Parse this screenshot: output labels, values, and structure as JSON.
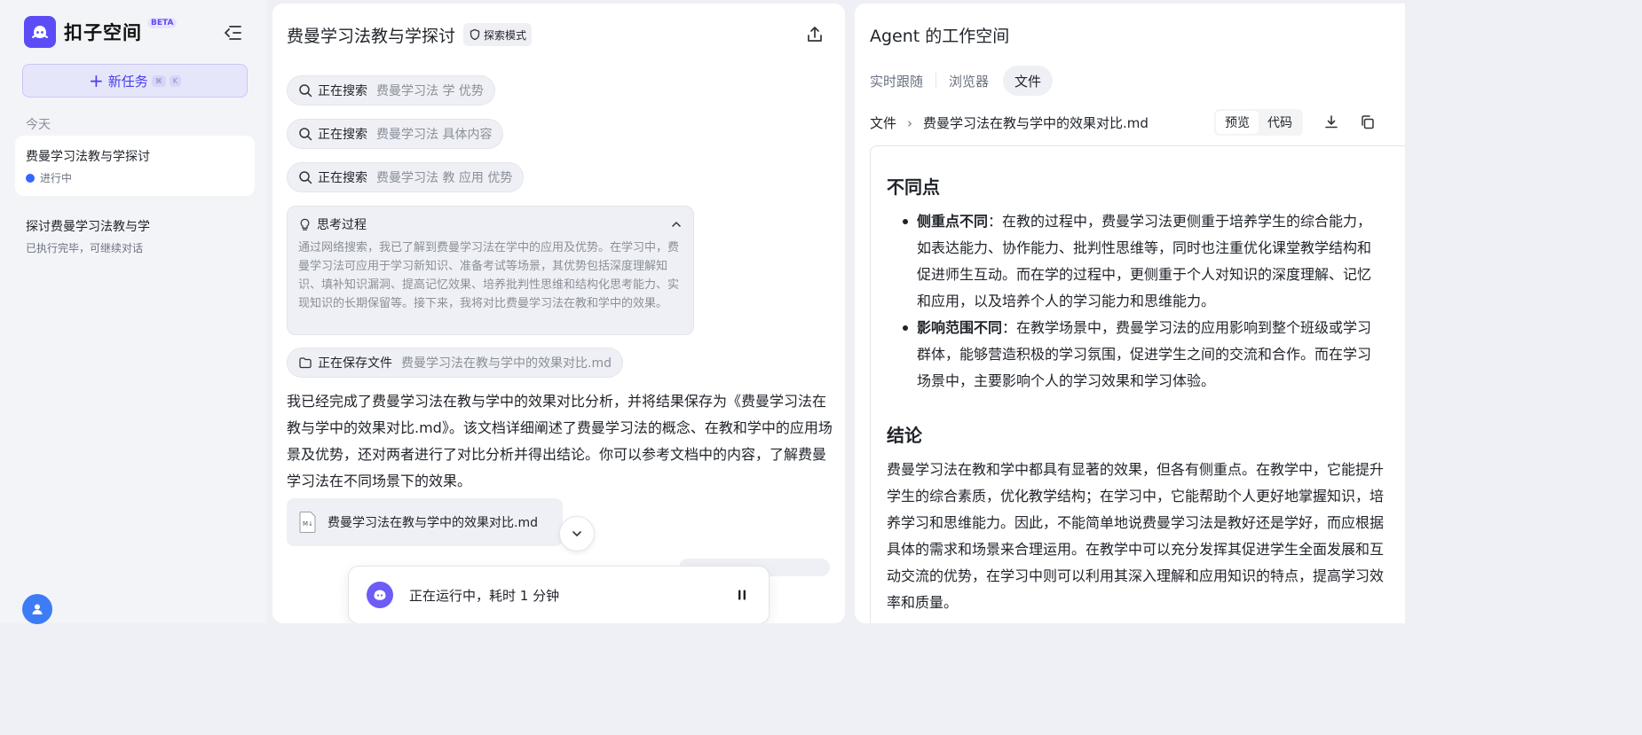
{
  "sidebar": {
    "brand": "扣子空间",
    "beta": "BETA",
    "new_task_label": "新任务",
    "new_task_kbd_1": "⌘",
    "new_task_kbd_2": "K",
    "section_today": "今天",
    "tasks": [
      {
        "title": "费曼学习法教与学探讨",
        "status": "进行中"
      },
      {
        "title": "探讨费曼学习法教与学",
        "status": "已执行完毕，可继续对话"
      }
    ]
  },
  "chat": {
    "title": "费曼学习法教与学探讨",
    "mode": "探索模式",
    "searches": [
      {
        "action": "正在搜索",
        "query": "费曼学习法 学 优势"
      },
      {
        "action": "正在搜索",
        "query": "费曼学习法 具体内容"
      },
      {
        "action": "正在搜索",
        "query": "费曼学习法 教 应用 优势"
      }
    ],
    "thinking": {
      "label": "思考过程",
      "text": "通过网络搜索，我已了解到费曼学习法在学中的应用及优势。在学习中，费曼学习法可应用于学习新知识、准备考试等场景，其优势包括深度理解知识、填补知识漏洞、提高记忆效果、培养批判性思维和结构化思考能力、实现知识的长期保留等。接下来，我将对比费曼学习法在教和学中的效果。"
    },
    "saving": {
      "action": "正在保存文件",
      "file": "费曼学习法在教与学中的效果对比.md"
    },
    "answer": "我已经完成了费曼学习法在教与学中的效果对比分析，并将结果保存为《费曼学习法在教与学中的效果对比.md》。该文档详细阐述了费曼学习法的概念、在教和学中的应用场景及优势，还对两者进行了对比分析并得出结论。你可以参考文档中的内容，了解费曼学习法在不同场景下的效果。",
    "file_card": {
      "icon_label": "M↓",
      "name": "费曼学习法在教与学中的效果对比.md"
    },
    "run_status": "正在运行中，耗时 1 分钟"
  },
  "workspace": {
    "title": "Agent 的工作空间",
    "tabs": [
      "实时跟随",
      "浏览器",
      "文件"
    ],
    "active_tab": "文件",
    "breadcrumb": {
      "root": "文件",
      "file": "费曼学习法在教与学中的效果对比.md"
    },
    "view_options": [
      "预览",
      "代码"
    ],
    "active_view": "预览",
    "doc": {
      "heading_diff": "不同点",
      "bullets": [
        {
          "bold": "侧重点不同",
          "text": "：在教的过程中，费曼学习法更侧重于培养学生的综合能力，如表达能力、协作能力、批判性思维等，同时也注重优化课堂教学结构和促进师生互动。而在学的过程中，更侧重于个人对知识的深度理解、记忆和应用，以及培养个人的学习能力和思维能力。"
        },
        {
          "bold": "影响范围不同",
          "text": "：在教学场景中，费曼学习法的应用影响到整个班级或学习群体，能够营造积极的学习氛围，促进学生之间的交流和合作。而在学习场景中，主要影响个人的学习效果和学习体验。"
        }
      ],
      "heading_conclusion": "结论",
      "conclusion": "费曼学习法在教和学中都具有显著的效果，但各有侧重点。在教学中，它能提升学生的综合素质，优化教学结构；在学习中，它能帮助个人更好地掌握知识，培养学习和思维能力。因此，不能简单地说费曼学习法是教好还是学好，而应根据具体的需求和场景来合理运用。在教学中可以充分发挥其促进学生全面发展和互动交流的优势，在学习中则可以利用其深入理解和应用知识的特点，提高学习效率和质量。"
    }
  },
  "colors": {
    "accent": "#5b4cf5",
    "status_dot": "#3466ff"
  },
  "icons": [
    "logo-icon",
    "collapse-sidebar-icon",
    "plus-icon",
    "user-icon",
    "share-icon",
    "shield-icon",
    "search-icon",
    "bulb-icon",
    "chevron-up-icon",
    "folder-icon",
    "markdown-file-icon",
    "chevron-down-icon",
    "agent-icon",
    "pause-icon",
    "chevron-right-icon",
    "download-icon",
    "copy-icon"
  ]
}
